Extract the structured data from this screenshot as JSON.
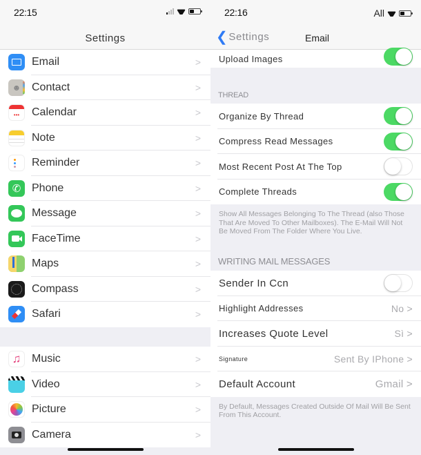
{
  "left": {
    "status": {
      "time": "22:15",
      "battery_percent": 40
    },
    "nav_title": "Settings",
    "group1": [
      {
        "label": "Email",
        "icon": "mail-icon",
        "color": "#2f8ef5"
      },
      {
        "label": "Contact",
        "icon": "contacts-icon",
        "color": "#c9c6c0"
      },
      {
        "label": "Calendar",
        "icon": "calendar-icon",
        "color": "#ffffff"
      },
      {
        "label": "Note",
        "icon": "notes-icon",
        "color": "#ffffff"
      },
      {
        "label": "Reminder",
        "icon": "reminders-icon",
        "color": "#ffffff"
      },
      {
        "label": "Phone",
        "icon": "phone-icon",
        "color": "#34c759"
      },
      {
        "label": "Message",
        "icon": "messages-icon",
        "color": "#34c759"
      },
      {
        "label": "FaceTime",
        "icon": "facetime-icon",
        "color": "#34c759"
      },
      {
        "label": "Maps",
        "icon": "maps-icon",
        "color": "#8fd16f"
      },
      {
        "label": "Compass",
        "icon": "compass-icon",
        "color": "#1a1a1a"
      },
      {
        "label": "Safari",
        "icon": "safari-icon",
        "color": "#2f8ef5"
      }
    ],
    "group2": [
      {
        "label": "Music",
        "icon": "music-icon",
        "color": "#ffffff"
      },
      {
        "label": "Video",
        "icon": "video-icon",
        "color": "#4ad0e6"
      },
      {
        "label": "Picture",
        "icon": "photos-icon",
        "color": "#ffffff"
      },
      {
        "label": "Camera",
        "icon": "camera-icon",
        "color": "#8e8e93"
      }
    ]
  },
  "right": {
    "status": {
      "time": "22:16",
      "carrier": "All",
      "battery_percent": 40
    },
    "back_label": "Settings",
    "nav_title": "Email",
    "top_row": {
      "label": "Upload Images",
      "on": true
    },
    "thread_header": "THREAD",
    "thread_rows": [
      {
        "label": "Organize By Thread",
        "on": true
      },
      {
        "label": "Compress Read Messages",
        "on": true
      },
      {
        "label": "Most Recent Post At The Top",
        "on": false
      },
      {
        "label": "Complete Threads",
        "on": true
      }
    ],
    "thread_footnote": "Show All Messages Belonging To The Thread (also Those That Are Moved To Other Mailboxes). The E-Mail Will Not Be Moved From The Folder Where You Live.",
    "writing_header": "WRITING MAIL MESSAGES",
    "writing_rows": [
      {
        "label": "Sender In Ccn",
        "type": "toggle",
        "on": false
      },
      {
        "label": "Highlight Addresses",
        "type": "value",
        "value": "No >"
      },
      {
        "label": "Increases Quote Level",
        "type": "value",
        "value": "Sì >"
      },
      {
        "label": "Signature",
        "type": "value",
        "value": "Sent By IPhone >"
      },
      {
        "label": "Default Account",
        "type": "value",
        "value": "Gmail >"
      }
    ],
    "account_footnote": "By Default, Messages Created Outside Of Mail Will Be Sent From This Account."
  },
  "colors": {
    "toggle_on": "#4cd964",
    "accent": "#2f7bf5"
  },
  "chevron": ">"
}
